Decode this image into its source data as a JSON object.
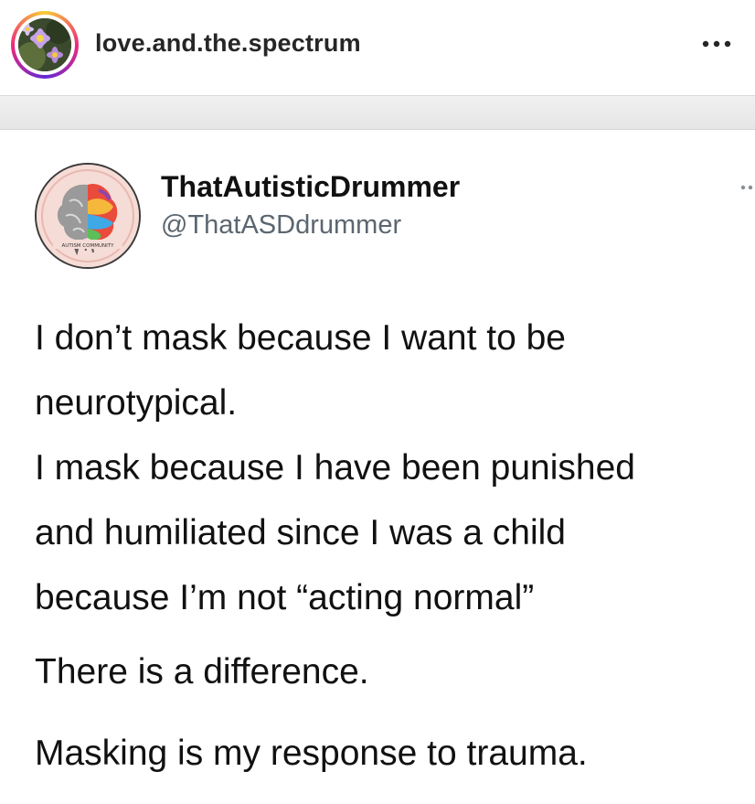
{
  "post": {
    "username": "love.and.the.spectrum",
    "more_icon": "more-horizontal-icon"
  },
  "tweet": {
    "display_name": "ThatAutisticDrummer",
    "handle": "@ThatASDdrummer",
    "avatar_caption": "AUTISM COMMUNITY",
    "lines": [
      "I don’t mask because I want to be",
      "neurotypical.",
      "I mask because I have been punished",
      "and humiliated since I was a child",
      "because I’m not “acting normal”"
    ],
    "line_difference": "There is a difference.",
    "line_trauma": "Masking is my response to trauma."
  },
  "colors": {
    "story_ring": [
      "#f9ce34",
      "#ee2a7b",
      "#6228d7"
    ],
    "handle_gray": "#5b6670"
  }
}
